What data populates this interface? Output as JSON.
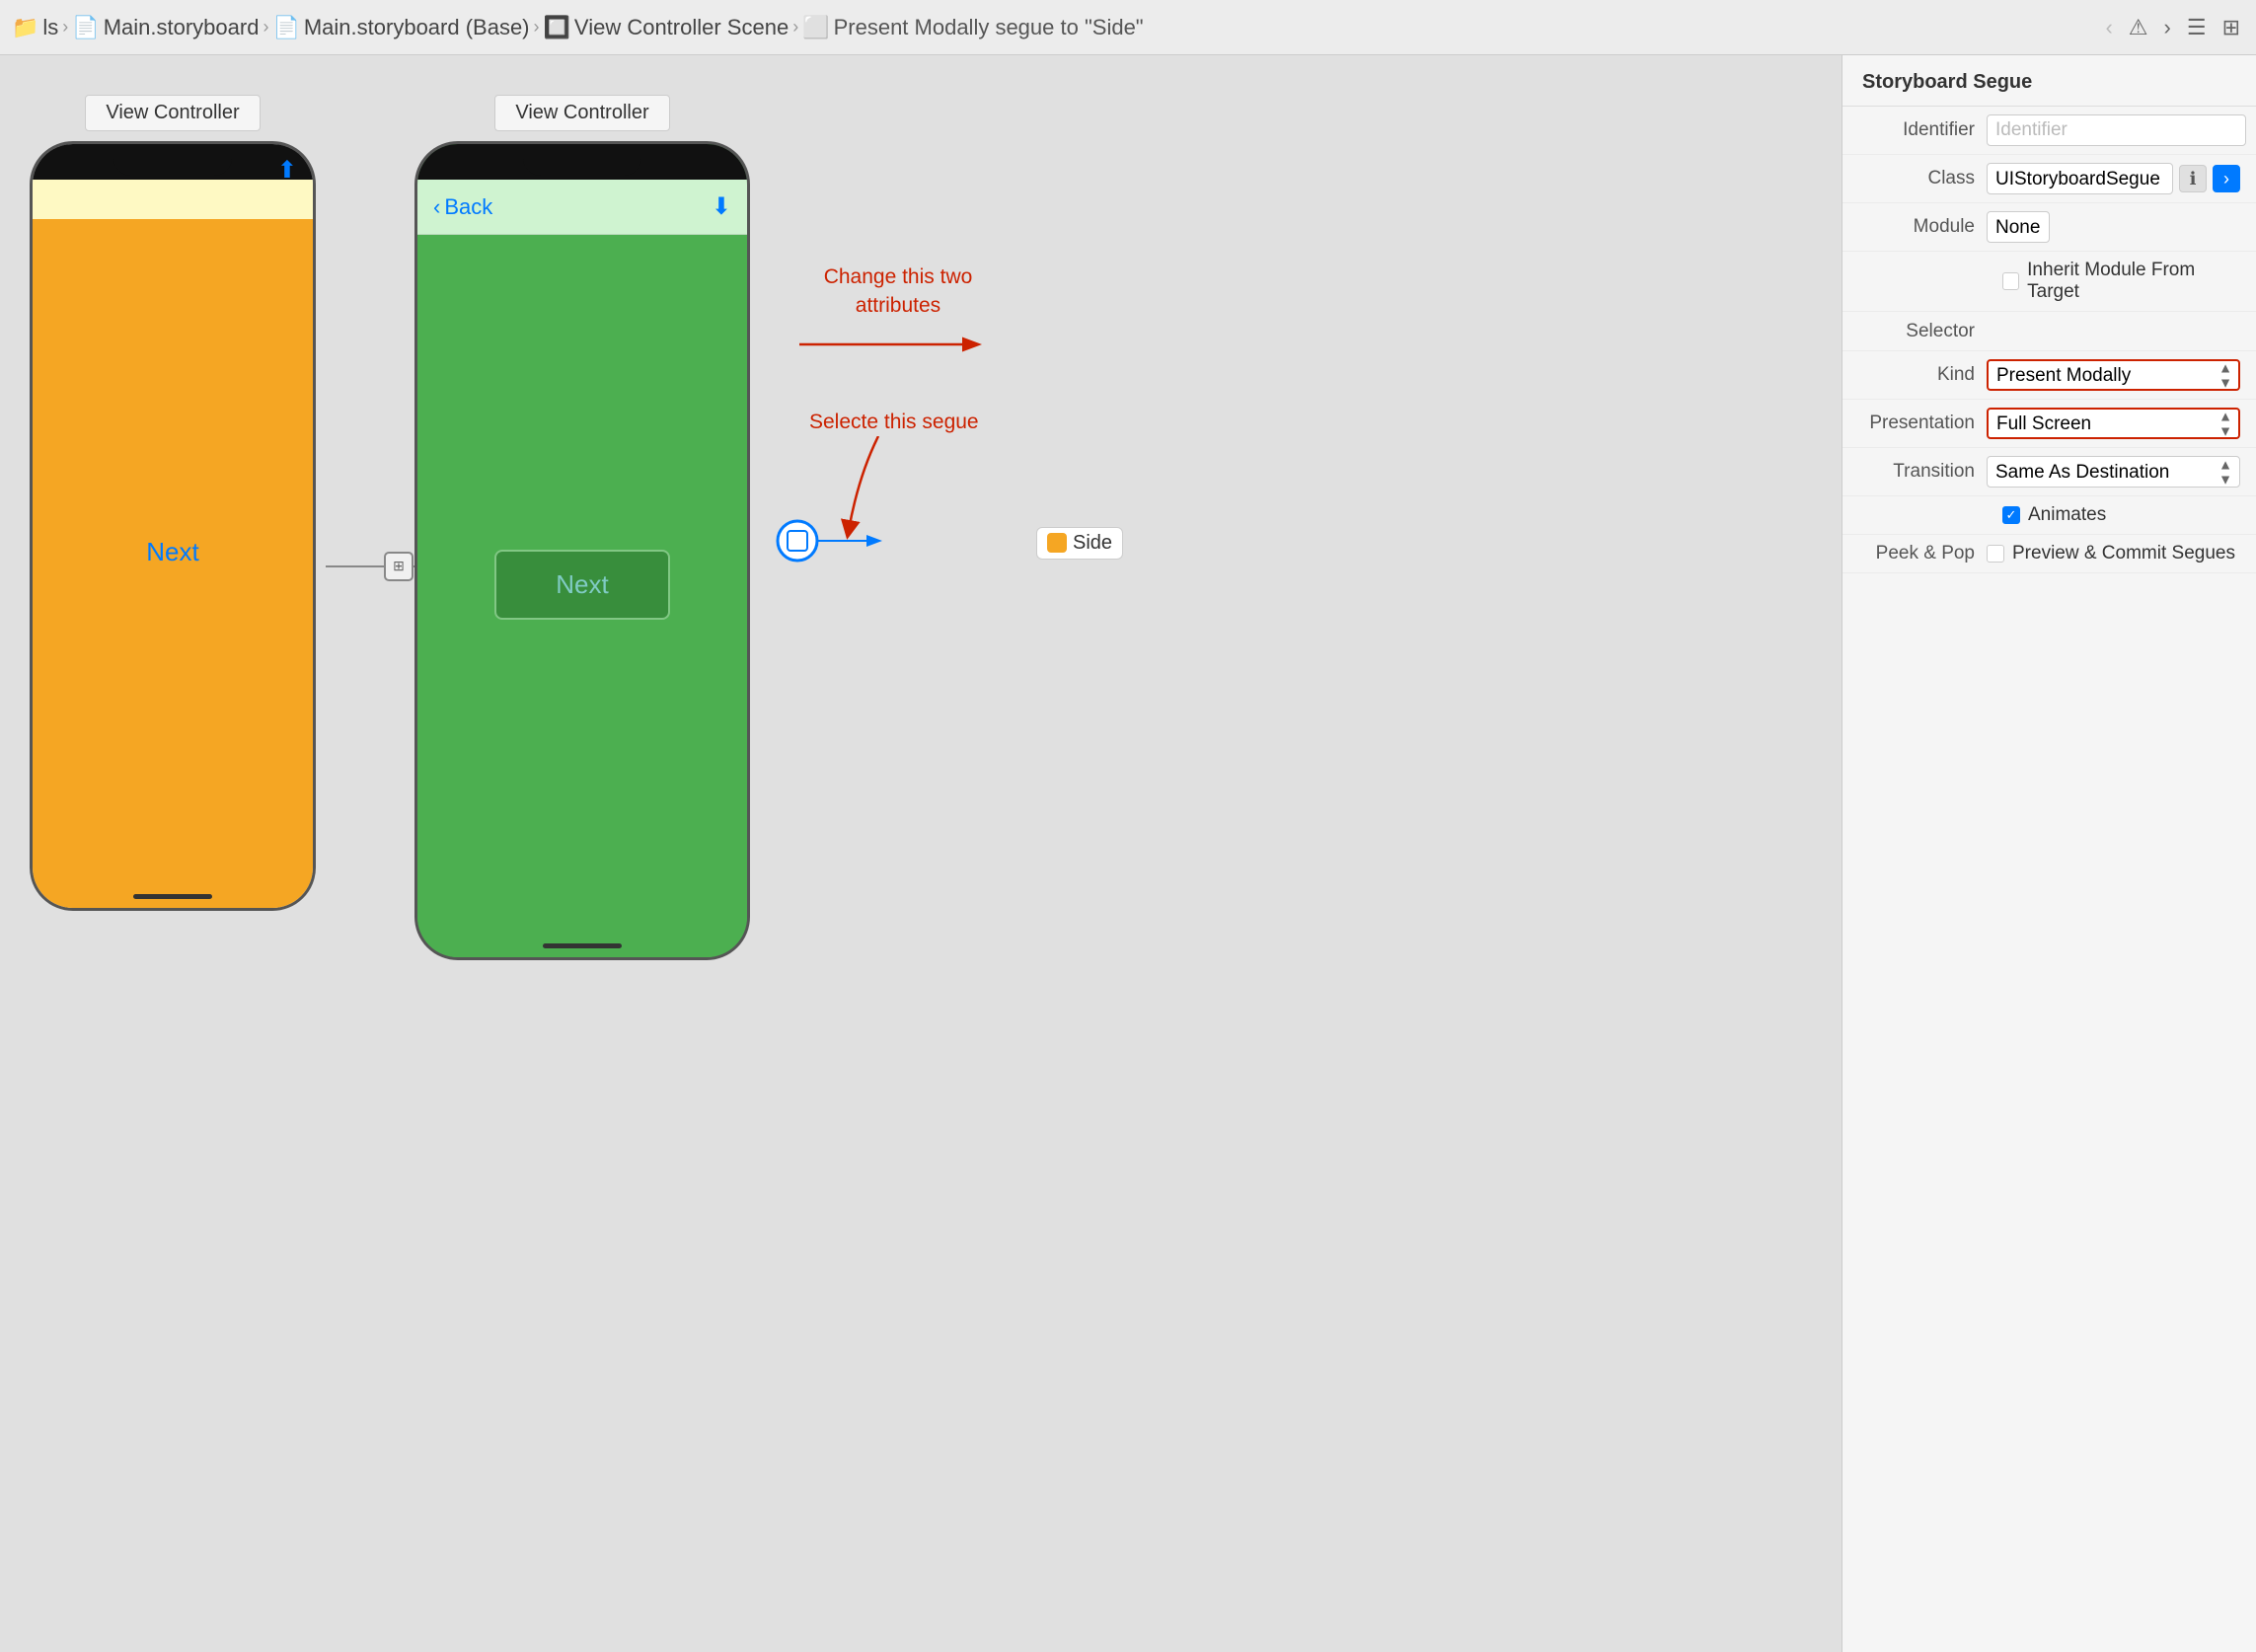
{
  "topbar": {
    "breadcrumbs": [
      {
        "label": "ls",
        "icon": "folder-icon"
      },
      {
        "label": "Main.storyboard",
        "icon": "storyboard-icon"
      },
      {
        "label": "Main.storyboard (Base)",
        "icon": "storyboard-base-icon"
      },
      {
        "label": "View Controller Scene",
        "icon": "scene-icon"
      },
      {
        "label": "Present Modally segue to \"Side\"",
        "icon": "segue-icon"
      }
    ]
  },
  "canvas": {
    "vc1": {
      "label": "View Controller",
      "next_label": "Next"
    },
    "vc2": {
      "label": "View Controller",
      "back_label": "Back",
      "next_label": "Next"
    },
    "annotations": {
      "change_text": "Change this two\nattributes",
      "select_text": "Selecte this segue"
    },
    "side_badge": "Side"
  },
  "right_panel": {
    "title": "Storyboard Segue",
    "fields": {
      "identifier": {
        "label": "Identifier",
        "placeholder": "Identifier"
      },
      "class": {
        "label": "Class",
        "value": "UIStoryboardSegue"
      },
      "module": {
        "label": "Module",
        "value": "None"
      },
      "inherit_module": {
        "label": "Inherit Module From Target"
      },
      "selector": {
        "label": "Selector"
      },
      "kind": {
        "label": "Kind",
        "value": "Present Modally"
      },
      "presentation": {
        "label": "Presentation",
        "value": "Full Screen"
      },
      "transition": {
        "label": "Transition",
        "value": "Same As Destination"
      },
      "animates": {
        "label": "Animates"
      },
      "peek_pop": {
        "label": "Peek & Pop",
        "value": "Preview & Commit Segues"
      }
    }
  }
}
